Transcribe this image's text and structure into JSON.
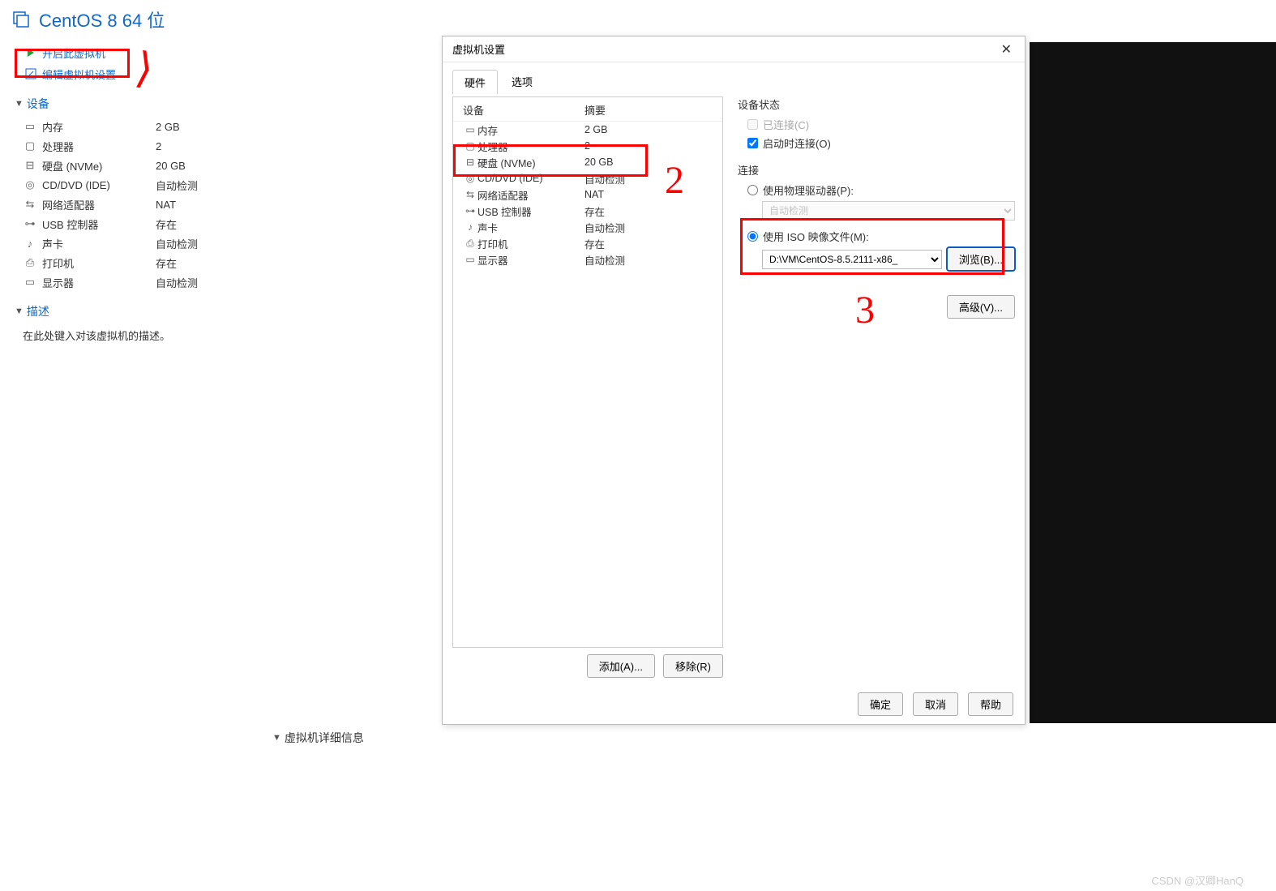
{
  "vm_title": "CentOS 8 64 位",
  "actions": {
    "power_on": "开启此虚拟机",
    "edit_settings": "编辑虚拟机设置"
  },
  "sections": {
    "devices": "设备",
    "description": "描述",
    "description_placeholder": "在此处键入对该虚拟机的描述。",
    "details": "虚拟机详细信息"
  },
  "devices": [
    {
      "icon": "memory",
      "name": "内存",
      "value": "2 GB"
    },
    {
      "icon": "cpu",
      "name": "处理器",
      "value": "2"
    },
    {
      "icon": "disk",
      "name": "硬盘 (NVMe)",
      "value": "20 GB"
    },
    {
      "icon": "cd",
      "name": "CD/DVD (IDE)",
      "value": "自动检测"
    },
    {
      "icon": "net",
      "name": "网络适配器",
      "value": "NAT"
    },
    {
      "icon": "usb",
      "name": "USB 控制器",
      "value": "存在"
    },
    {
      "icon": "sound",
      "name": "声卡",
      "value": "自动检测"
    },
    {
      "icon": "printer",
      "name": "打印机",
      "value": "存在"
    },
    {
      "icon": "display",
      "name": "显示器",
      "value": "自动检测"
    }
  ],
  "dialog": {
    "title": "虚拟机设置",
    "tabs": {
      "hardware": "硬件",
      "options": "选项"
    },
    "hw_hdr": {
      "device": "设备",
      "summary": "摘要"
    },
    "hw_rows": [
      {
        "icon": "memory",
        "name": "内存",
        "value": "2 GB"
      },
      {
        "icon": "cpu",
        "name": "处理器",
        "value": "2"
      },
      {
        "icon": "disk",
        "name": "硬盘 (NVMe)",
        "value": "20 GB"
      },
      {
        "icon": "cd",
        "name": "CD/DVD (IDE)",
        "value": "自动检测"
      },
      {
        "icon": "net",
        "name": "网络适配器",
        "value": "NAT"
      },
      {
        "icon": "usb",
        "name": "USB 控制器",
        "value": "存在"
      },
      {
        "icon": "sound",
        "name": "声卡",
        "value": "自动检测"
      },
      {
        "icon": "printer",
        "name": "打印机",
        "value": "存在"
      },
      {
        "icon": "display",
        "name": "显示器",
        "value": "自动检测"
      }
    ],
    "add_btn": "添加(A)...",
    "remove_btn": "移除(R)",
    "state_group": "设备状态",
    "connected": "已连接(C)",
    "connect_at_power": "启动时连接(O)",
    "conn_group": "连接",
    "use_physical": "使用物理驱动器(P):",
    "physical_value": "自动检测",
    "use_iso": "使用 ISO 映像文件(M):",
    "iso_value": "D:\\VM\\CentOS-8.5.2111-x86_",
    "browse": "浏览(B)...",
    "advanced": "高级(V)...",
    "ok": "确定",
    "cancel": "取消",
    "help": "帮助"
  },
  "watermark": "CSDN @汉卿HanQ"
}
